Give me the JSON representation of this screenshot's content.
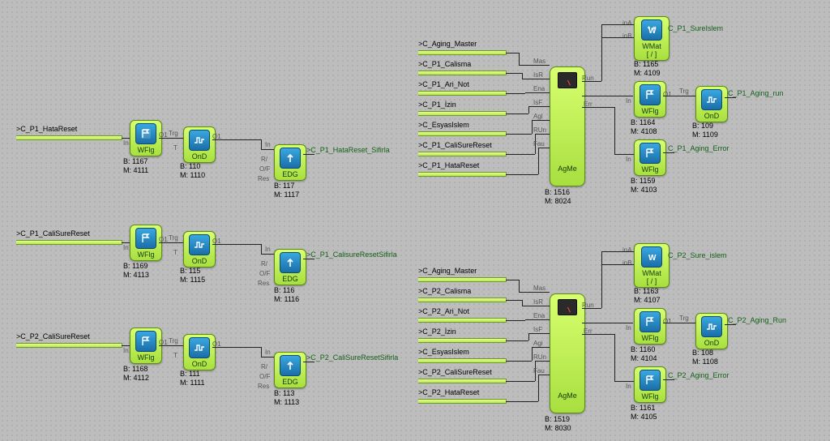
{
  "left": {
    "rows": [
      {
        "anchor": ">C_P1_HataReset",
        "wflg": {
          "b": "B: 1167",
          "m": "M: 4111"
        },
        "ond": {
          "b": "B: 110",
          "m": "M: 1110"
        },
        "edg": {
          "b": "B: 117",
          "m": "M: 1117"
        },
        "out": ">C_P1_HataReset_Sifirla"
      },
      {
        "anchor": ">C_P1_CaliSureReset",
        "wflg": {
          "b": "B: 1169",
          "m": "M: 4113"
        },
        "ond": {
          "b": "B: 115",
          "m": "M: 1115"
        },
        "edg": {
          "b": "B: 116",
          "m": "M: 1116"
        },
        "out": ">C_P1_CalisureResetSifirla"
      },
      {
        "anchor": ">C_P2_CaliSureReset",
        "wflg": {
          "b": "B: 1168",
          "m": "M: 4112"
        },
        "ond": {
          "b": "B: 111",
          "m": "M: 1111"
        },
        "edg": {
          "b": "B: 113",
          "m": "M: 1113"
        },
        "out": ">C_P2_CaliSureResetSifirla"
      }
    ]
  },
  "right": {
    "groups": [
      {
        "anchors": [
          ">C_Aging_Master",
          ">C_P1_Calisma",
          ">C_P1_Ari_Not",
          ">C_P1_İzin",
          ">C_EsyasIslem",
          ">C_P1_CaliSureReset",
          ">C_P1_HataReset"
        ],
        "agme": {
          "b": "B: 1516",
          "m": "M: 8024"
        },
        "wmat": {
          "b": "B: 1165",
          "m": "M: 4109",
          "out": "C_P1_SureIslem"
        },
        "wflg_run": {
          "b": "B: 1164",
          "m": "M: 4108"
        },
        "ond": {
          "b": "B: 109",
          "m": "M: 1109",
          "out": "C_P1_Aging_run"
        },
        "wflg_err": {
          "b": "B: 1159",
          "m": "M: 4103",
          "out": "C_P1_Aging_Error"
        }
      },
      {
        "anchors": [
          ">C_Aging_Master",
          ">C_P2_Calisma",
          ">C_P2_Ari_Not",
          ">C_P2_İzin",
          ">C_EsyasIslem",
          ">C_P2_CaliSureReset",
          ">C_P2_HataReset"
        ],
        "agme": {
          "b": "B: 1519",
          "m": "M: 8030"
        },
        "wmat": {
          "b": "B: 1163",
          "m": "M: 4107",
          "out": "C_P2_Sure_islem"
        },
        "wflg_run": {
          "b": "B: 1160",
          "m": "M: 4104"
        },
        "ond": {
          "b": "B: 108",
          "m": "M: 1108",
          "out": "C_P2_Aging_Run"
        },
        "wflg_err": {
          "b": "B: 1161",
          "m": "M: 4105",
          "out": "C_P2_Aging_Error"
        }
      }
    ],
    "ports_left": [
      "Mas",
      "IsR",
      "Ena",
      "IsF",
      "Agi",
      "RUn",
      "Fau",
      "Fau"
    ],
    "ports_right": [
      "Run",
      "Err"
    ]
  },
  "labels": {
    "WFlg": "WFlg",
    "OnD": "OnD",
    "EDG": "EDG",
    "WMat": "WMat",
    "WMat2": "[ / ]",
    "AgMe": "AgMe",
    "In": "In",
    "Trg": "Trg",
    "T": "T",
    "O1": "O1",
    "R/": "R/",
    "O/F": "O/F",
    "Res": "Res",
    "inA": "inA",
    "inB": "inB"
  }
}
